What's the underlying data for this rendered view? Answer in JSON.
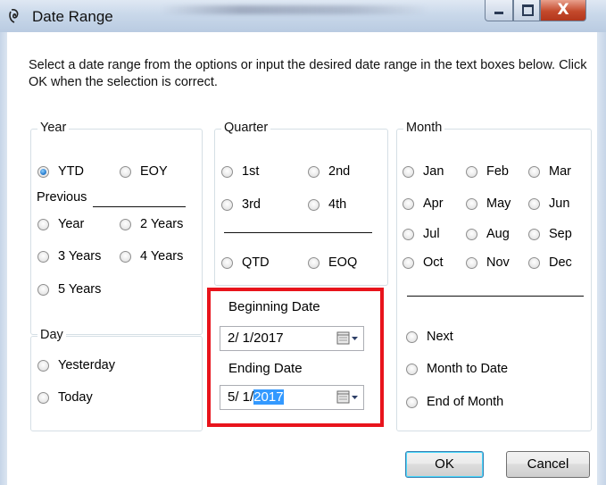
{
  "window": {
    "title": "Date Range"
  },
  "instructions": "Select a date range from the options or input the desired date range in the text boxes below. Click OK when the selection is correct.",
  "year": {
    "legend": "Year",
    "options": [
      {
        "label": "YTD",
        "checked": true
      },
      {
        "label": "EOY",
        "checked": false
      }
    ],
    "previous_label": "Previous",
    "previous_options": [
      {
        "label": "Year",
        "checked": false
      },
      {
        "label": "2 Years",
        "checked": false
      },
      {
        "label": "3 Years",
        "checked": false
      },
      {
        "label": "4 Years",
        "checked": false
      },
      {
        "label": "5 Years",
        "checked": false
      }
    ]
  },
  "quarter": {
    "legend": "Quarter",
    "options": [
      {
        "label": "1st",
        "checked": false
      },
      {
        "label": "2nd",
        "checked": false
      },
      {
        "label": "3rd",
        "checked": false
      },
      {
        "label": "4th",
        "checked": false
      },
      {
        "label": "QTD",
        "checked": false
      },
      {
        "label": "EOQ",
        "checked": false
      }
    ]
  },
  "month": {
    "legend": "Month",
    "options": [
      {
        "label": "Jan",
        "checked": false
      },
      {
        "label": "Feb",
        "checked": false
      },
      {
        "label": "Mar",
        "checked": false
      },
      {
        "label": "Apr",
        "checked": false
      },
      {
        "label": "May",
        "checked": false
      },
      {
        "label": "Jun",
        "checked": false
      },
      {
        "label": "Jul",
        "checked": false
      },
      {
        "label": "Aug",
        "checked": false
      },
      {
        "label": "Sep",
        "checked": false
      },
      {
        "label": "Oct",
        "checked": false
      },
      {
        "label": "Nov",
        "checked": false
      },
      {
        "label": "Dec",
        "checked": false
      }
    ],
    "extra_options": [
      {
        "label": "Next",
        "checked": false
      },
      {
        "label": "Month to Date",
        "checked": false
      },
      {
        "label": "End of Month",
        "checked": false
      }
    ]
  },
  "day": {
    "legend": "Day",
    "options": [
      {
        "label": "Yesterday",
        "checked": false
      },
      {
        "label": "Today",
        "checked": false
      }
    ]
  },
  "dates": {
    "beginning_label": "Beginning Date",
    "beginning_value": "2/ 1/2017",
    "ending_label": "Ending Date",
    "ending_value_prefix": "5/ 1/",
    "ending_value_selected": "2017"
  },
  "buttons": {
    "ok": "OK",
    "cancel": "Cancel"
  },
  "colors": {
    "highlight": "#e8141c",
    "selection": "#3399ff"
  }
}
